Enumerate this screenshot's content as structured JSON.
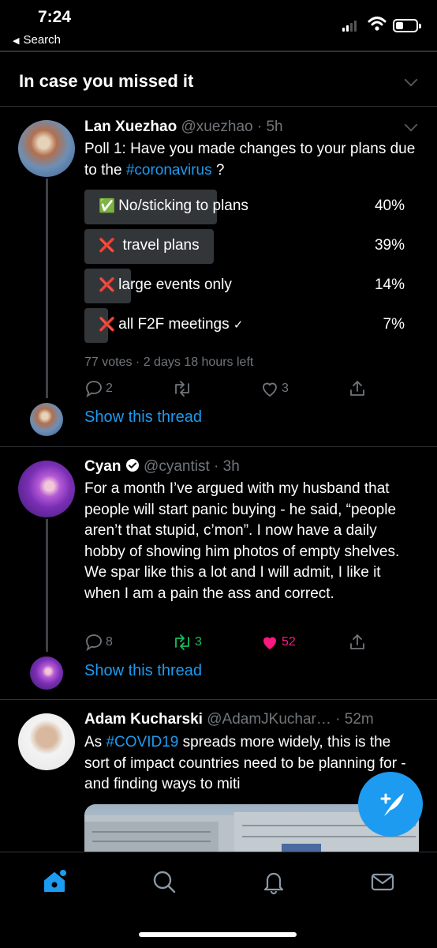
{
  "status_bar": {
    "time": "7:24",
    "back_label": "Search"
  },
  "section": {
    "title": "In case you missed it"
  },
  "colors": {
    "accent": "#1d9bf0",
    "like": "#f91880",
    "retweet": "#17bf63",
    "background": "#000000"
  },
  "tweets": [
    {
      "name": "Lan Xuezhao",
      "handle": "@xuezhao",
      "time": "5h",
      "text_before": "Poll 1: Have you made changes to your plans due to the ",
      "hashtag": "#coronavirus",
      "text_after": " ?",
      "poll": {
        "options": [
          {
            "icon": "✅",
            "label": "No/sticking to plans",
            "percent": "40%",
            "value": 40
          },
          {
            "icon": "❌",
            "label": " travel plans",
            "percent": "39%",
            "value": 39
          },
          {
            "icon": "❌",
            "label": "large events only",
            "percent": "14%",
            "value": 14
          },
          {
            "icon": "❌",
            "label": "all F2F meetings",
            "percent": "7%",
            "value": 7
          }
        ],
        "summary": "77 votes · 2 days 18 hours left"
      },
      "replies": "2",
      "retweets": "",
      "likes": "3",
      "show_thread": "Show this thread"
    },
    {
      "name": "Cyan",
      "handle": "@cyantist",
      "time": "3h",
      "text": "For a month I’ve argued with my husband that people will start panic buying - he said, “people aren’t that stupid, c’mon”. I now have a daily hobby of showing him photos of empty shelves. We spar like this a lot and I will admit, I like it when I am a pain the ass and correct.",
      "replies": "8",
      "retweets": "3",
      "likes": "52",
      "show_thread": "Show this thread"
    },
    {
      "name": "Adam Kucharski",
      "handle": "@AdamJKuchar…",
      "time": "52m",
      "text_before": "As ",
      "hashtag": "#COVID19",
      "text_after": " spreads more widely, this is the sort of impact countries need to be planning for - and finding ways to miti"
    }
  ],
  "tabbar": {
    "icons": [
      "home-icon",
      "search-icon",
      "notifications-icon",
      "messages-icon"
    ]
  }
}
